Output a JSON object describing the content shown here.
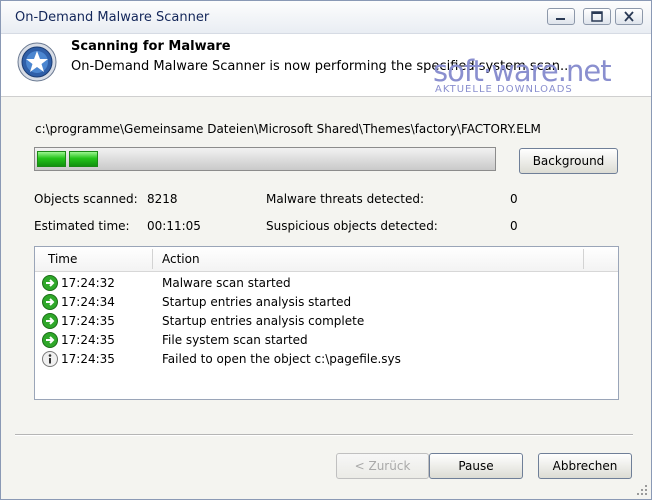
{
  "window": {
    "title": "On-Demand Malware Scanner"
  },
  "header": {
    "title": "Scanning for Malware",
    "subtitle": "On-Demand Malware Scanner is now performing the specified system scan..."
  },
  "watermark": {
    "brand": "soft·ware.net",
    "tagline": "AKTUELLE DOWNLOADS"
  },
  "scan": {
    "current_path": "c:\\programme\\Gemeinsame Dateien\\Microsoft Shared\\Themes\\factory\\FACTORY.ELM",
    "progress_fraction": 0.14,
    "background_label": "Background",
    "objects_scanned_label": "Objects scanned:",
    "objects_scanned_value": "8218",
    "estimated_time_label": "Estimated time:",
    "estimated_time_value": "00:11:05",
    "malware_threats_label": "Malware threats detected:",
    "malware_threats_value": "0",
    "suspicious_label": "Suspicious objects detected:",
    "suspicious_value": "0"
  },
  "log": {
    "columns": {
      "time": "Time",
      "action": "Action"
    },
    "rows": [
      {
        "icon": "arrow-ok-icon",
        "time": "17:24:32",
        "action": "Malware scan started"
      },
      {
        "icon": "arrow-ok-icon",
        "time": "17:24:34",
        "action": "Startup entries analysis started"
      },
      {
        "icon": "arrow-ok-icon",
        "time": "17:24:35",
        "action": "Startup entries analysis complete"
      },
      {
        "icon": "arrow-ok-icon",
        "time": "17:24:35",
        "action": "File system scan started"
      },
      {
        "icon": "info-icon",
        "time": "17:24:35",
        "action": "Failed to open the object c:\\pagefile.sys"
      }
    ]
  },
  "footer": {
    "back_label": "< Zurück",
    "pause_label": "Pause",
    "cancel_label": "Abbrechen"
  },
  "colors": {
    "accent_green": "#24c41a",
    "title_blue": "#14275a",
    "watermark": "#8a8fcf"
  }
}
